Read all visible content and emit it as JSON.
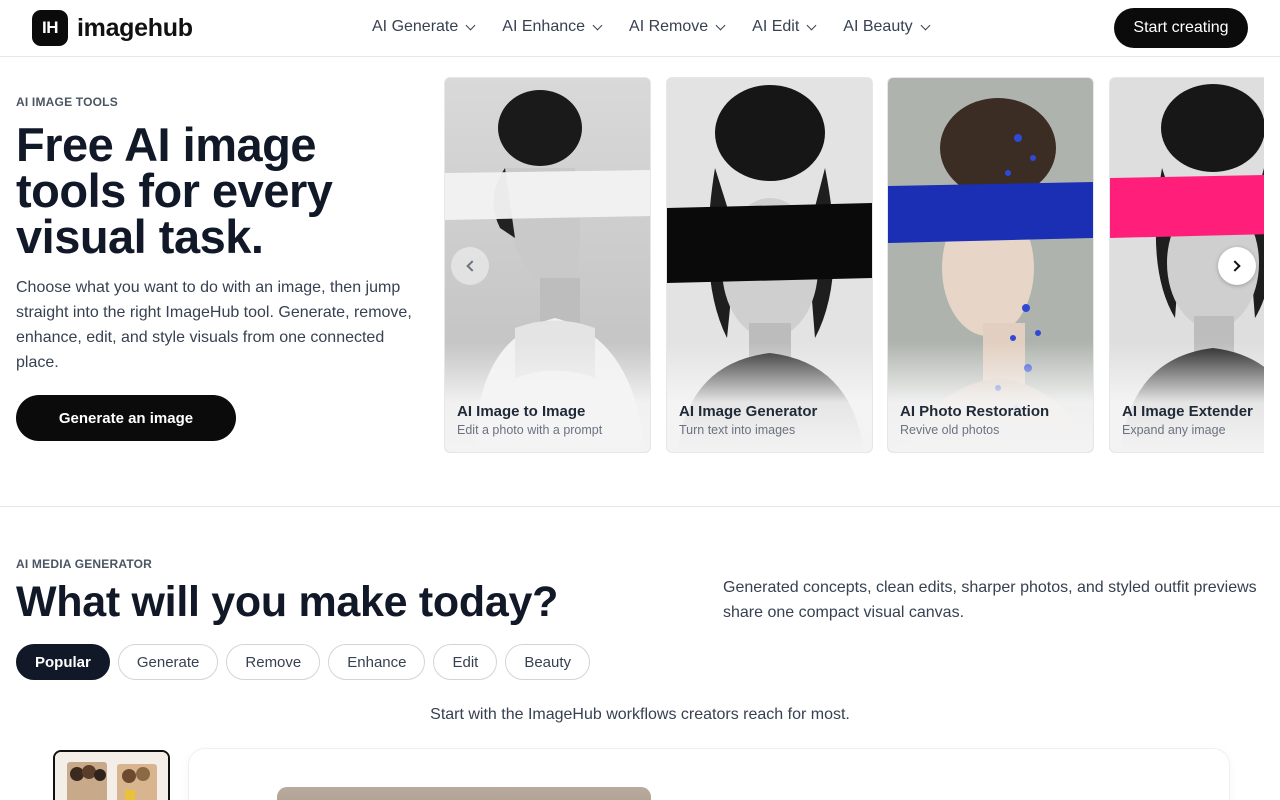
{
  "header": {
    "logo_mark": "IH",
    "brand": "imagehub",
    "nav": [
      {
        "label": "AI Generate"
      },
      {
        "label": "AI Enhance"
      },
      {
        "label": "AI Remove"
      },
      {
        "label": "AI Edit"
      },
      {
        "label": "AI Beauty"
      }
    ],
    "cta": "Start creating"
  },
  "hero": {
    "eyebrow": "AI IMAGE TOOLS",
    "title": "Free AI image tools for every visual task.",
    "description": "Choose what you want to do with an image, then jump straight into the right ImageHub tool. Generate, remove, enhance, edit, and style visuals from one connected place.",
    "button": "Generate an image"
  },
  "carousel": {
    "cards": [
      {
        "title": "AI Image to Image",
        "subtitle": "Edit a photo with a prompt",
        "stroke_color": "#f2f2f2"
      },
      {
        "title": "AI Image Generator",
        "subtitle": "Turn text into images",
        "stroke_color": "#0a0a0a"
      },
      {
        "title": "AI Photo Restoration",
        "subtitle": "Revive old photos",
        "stroke_color": "#1b2fb5"
      },
      {
        "title": "AI Image Extender",
        "subtitle": "Expand any image",
        "stroke_color": "#ff1f7a"
      }
    ],
    "prev_icon": "chevron-left-icon",
    "next_icon": "chevron-right-icon"
  },
  "section": {
    "eyebrow": "AI MEDIA GENERATOR",
    "title": "What will you make today?",
    "description": "Generated concepts, clean edits, sharper photos, and styled outfit previews share one compact visual canvas.",
    "tabs": [
      {
        "label": "Popular",
        "active": true
      },
      {
        "label": "Generate"
      },
      {
        "label": "Remove"
      },
      {
        "label": "Enhance"
      },
      {
        "label": "Edit"
      },
      {
        "label": "Beauty"
      }
    ],
    "note": "Start with the ImageHub workflows creators reach for most."
  }
}
